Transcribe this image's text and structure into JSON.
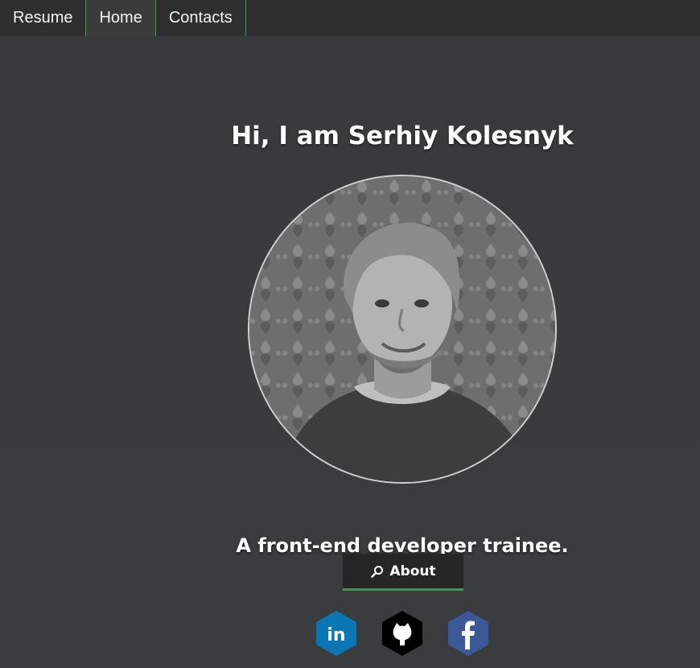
{
  "nav": {
    "items": [
      {
        "label": "Resume",
        "active": false
      },
      {
        "label": "Home",
        "active": true
      },
      {
        "label": "Contacts",
        "active": false
      }
    ]
  },
  "hero": {
    "title": "Hi, I am Serhiy Kolesnyk",
    "subtitle": "A front-end developer trainee.",
    "about_label": "About",
    "about_icon": "search-icon"
  },
  "social": [
    {
      "name": "linkedin-icon",
      "color": "#0a77b5",
      "glyph": "in"
    },
    {
      "name": "github-icon",
      "color": "#000000",
      "glyph": ""
    },
    {
      "name": "facebook-icon",
      "color": "#3b5998",
      "glyph": "f"
    }
  ],
  "colors": {
    "accent": "#2e9e55",
    "background": "#3a3a3c",
    "navbar": "#2f2f2f",
    "button": "#262626"
  }
}
